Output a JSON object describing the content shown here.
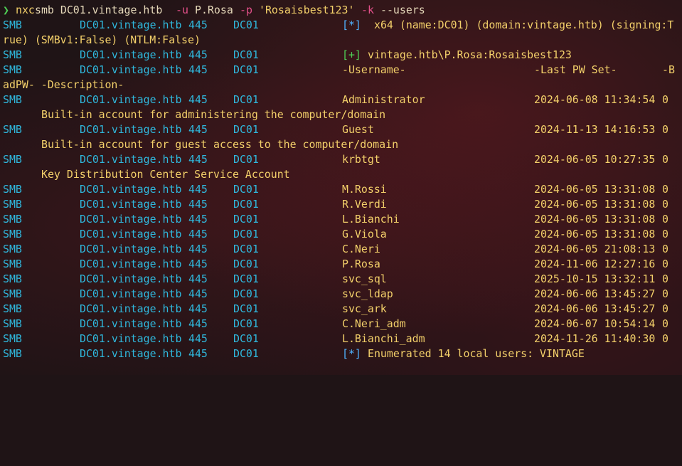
{
  "prompt": {
    "symbol": "❯",
    "cmd": "nxc",
    "args1": "smb DC01.vintage.htb",
    "flag_u": "-u",
    "user": "P.Rosa",
    "flag_p": "-p",
    "password": "'Rosaisbest123'",
    "flag_k": "-k",
    "flag_users": "--users"
  },
  "info": {
    "marker": "[*]",
    "text": "x64 (name:DC01) (domain:vintage.htb) (signing:T",
    "wrap": "rue) (SMBv1:False) (NTLM:False)"
  },
  "auth": {
    "marker": "[+]",
    "text": "vintage.htb\\P.Rosa:Rosaisbest123"
  },
  "columns": {
    "username": "-Username-",
    "last_pw": "-Last PW Set-",
    "badpw_start": "-B",
    "wrap": "adPW- -Description-"
  },
  "proto": "SMB",
  "host": "DC01.vintage.htb",
  "port": "445",
  "name": "DC01",
  "users": [
    {
      "username": "Administrator",
      "last_pw": "2024-06-08 11:34:54",
      "badpw": "0",
      "description": "Built-in account for administering the computer/domain"
    },
    {
      "username": "Guest",
      "last_pw": "2024-11-13 14:16:53",
      "badpw": "0",
      "description": "Built-in account for guest access to the computer/domain"
    },
    {
      "username": "krbtgt",
      "last_pw": "2024-06-05 10:27:35",
      "badpw": "0",
      "description": "Key Distribution Center Service Account"
    },
    {
      "username": "M.Rossi",
      "last_pw": "2024-06-05 13:31:08",
      "badpw": "0"
    },
    {
      "username": "R.Verdi",
      "last_pw": "2024-06-05 13:31:08",
      "badpw": "0"
    },
    {
      "username": "L.Bianchi",
      "last_pw": "2024-06-05 13:31:08",
      "badpw": "0"
    },
    {
      "username": "G.Viola",
      "last_pw": "2024-06-05 13:31:08",
      "badpw": "0"
    },
    {
      "username": "C.Neri",
      "last_pw": "2024-06-05 21:08:13",
      "badpw": "0"
    },
    {
      "username": "P.Rosa",
      "last_pw": "2024-11-06 12:27:16",
      "badpw": "0"
    },
    {
      "username": "svc_sql",
      "last_pw": "2025-10-15 13:32:11",
      "badpw": "0"
    },
    {
      "username": "svc_ldap",
      "last_pw": "2024-06-06 13:45:27",
      "badpw": "0"
    },
    {
      "username": "svc_ark",
      "last_pw": "2024-06-06 13:45:27",
      "badpw": "0"
    },
    {
      "username": "C.Neri_adm",
      "last_pw": "2024-06-07 10:54:14",
      "badpw": "0"
    },
    {
      "username": "L.Bianchi_adm",
      "last_pw": "2024-11-26 11:40:30",
      "badpw": "0"
    }
  ],
  "summary": {
    "marker": "[*]",
    "text": "Enumerated 14 local users: VINTAGE"
  },
  "colors": {
    "background": "#1f1416",
    "cyan": "#2fb8dd",
    "yellow": "#f3d06a",
    "pink": "#e3508a",
    "green": "#4fcf55",
    "blue": "#4fb2ff"
  }
}
